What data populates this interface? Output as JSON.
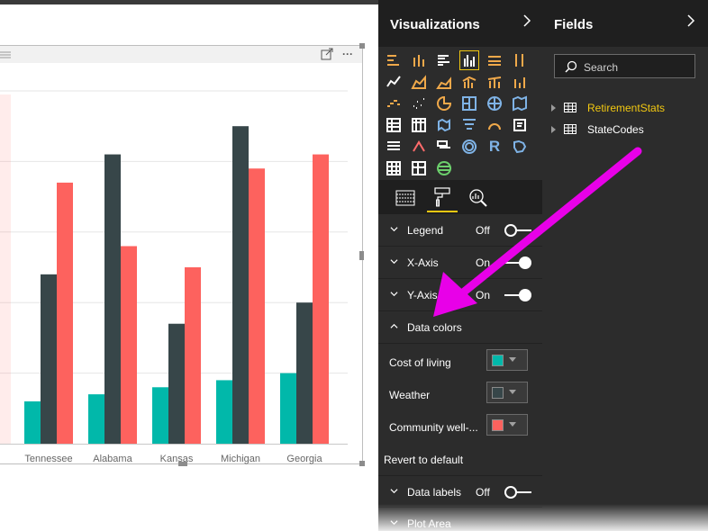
{
  "colors": {
    "cost_of_living": "#01b8aa",
    "weather": "#374649",
    "community": "#fd625e",
    "accent": "#f2c811",
    "arrow": "#e800e8"
  },
  "chart_data": {
    "type": "bar",
    "categories": [
      "Tennessee",
      "Alabama",
      "Kansas",
      "Michigan",
      "Georgia"
    ],
    "series": [
      {
        "name": "Cost of living",
        "values": [
          6,
          7,
          8,
          9,
          10
        ]
      },
      {
        "name": "Weather",
        "values": [
          24,
          41,
          17,
          45,
          20
        ]
      },
      {
        "name": "Community well-being",
        "values": [
          37,
          28,
          25,
          39,
          41
        ]
      }
    ],
    "ylim": [
      0,
      50
    ],
    "grid": true,
    "legend": "none"
  },
  "visual_header": {
    "focus_icon": "focus-mode-icon",
    "more_label": "···"
  },
  "visualizations": {
    "title": "Visualizations",
    "more_label": "···",
    "tabs": [
      "fields-well-icon",
      "format-paint-roller-icon",
      "analytics-magnifier-icon"
    ],
    "format_sections": [
      {
        "label": "Legend",
        "state": "Off",
        "toggle": "off"
      },
      {
        "label": "X-Axis",
        "state": "On",
        "toggle": "on"
      },
      {
        "label": "Y-Axis",
        "state": "On",
        "toggle": "on"
      }
    ],
    "data_colors": {
      "label": "Data colors",
      "rows": [
        {
          "label": "Cost of living"
        },
        {
          "label": "Weather"
        },
        {
          "label": "Community well-..."
        }
      ],
      "revert_label": "Revert to default"
    },
    "data_labels": {
      "label": "Data labels",
      "state": "Off"
    },
    "plot_area": {
      "label": "Plot Area"
    }
  },
  "fields": {
    "title": "Fields",
    "search_placeholder": "Search",
    "tables": [
      {
        "name": "RetirementStats",
        "color": "#f2c811"
      },
      {
        "name": "StateCodes",
        "color": "#ffffff"
      }
    ]
  }
}
